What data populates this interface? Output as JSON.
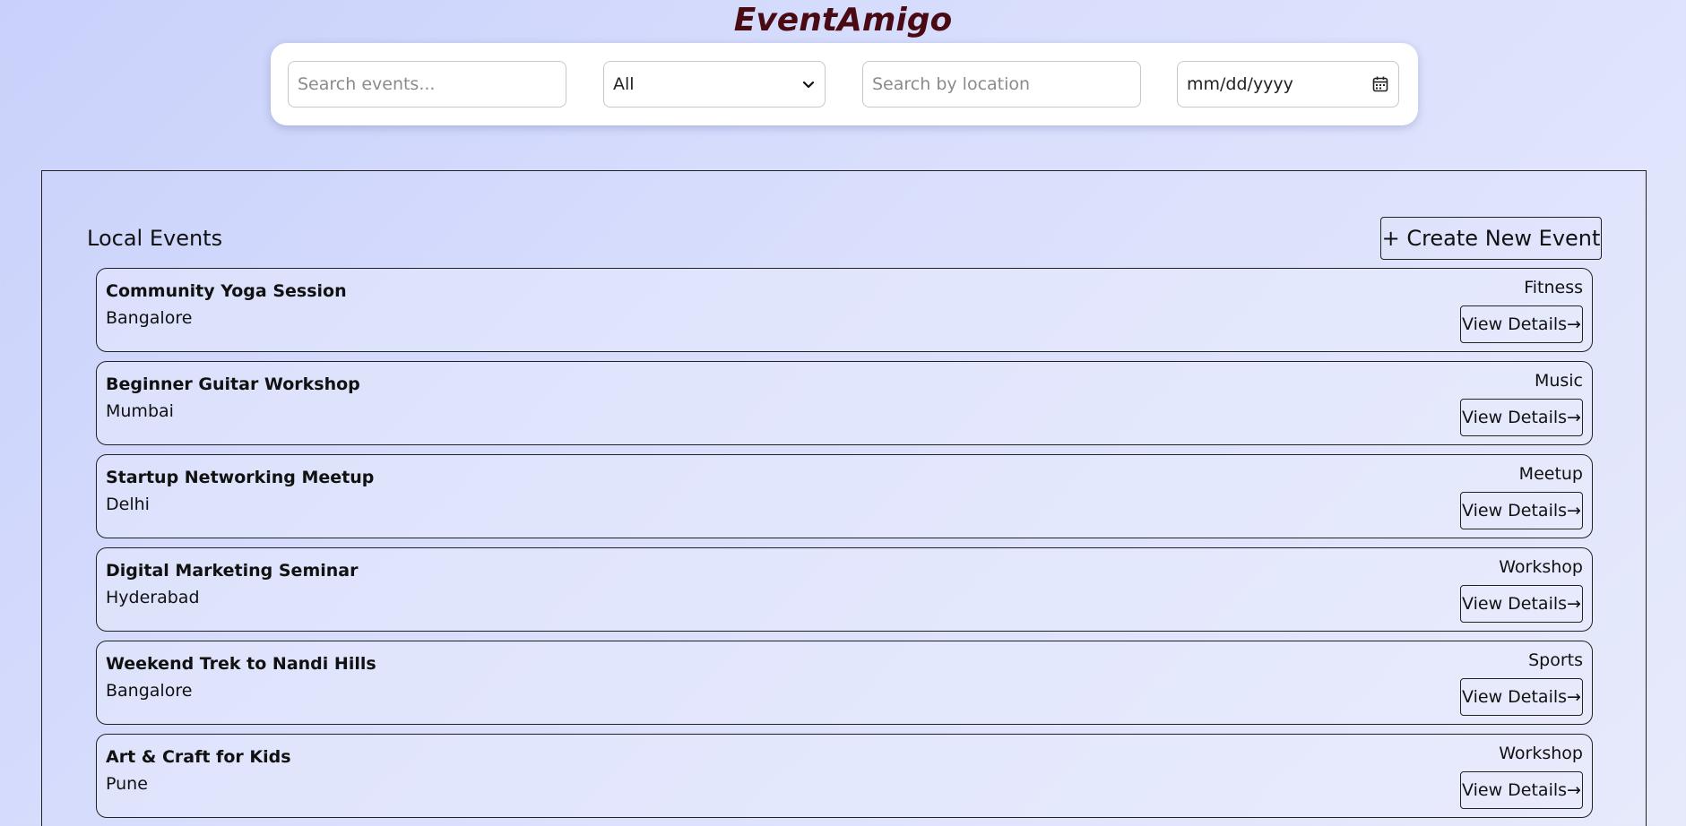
{
  "app": {
    "title": "EventAmigo"
  },
  "filters": {
    "search_placeholder": "Search events...",
    "category_value": "All",
    "location_placeholder": "Search by location",
    "date_placeholder": "mm/dd/yyyy"
  },
  "section": {
    "title": "Local Events",
    "create_label": "+ Create New Event"
  },
  "events": [
    {
      "title": "Community Yoga Session",
      "location": "Bangalore",
      "category": "Fitness",
      "action": "View Details→"
    },
    {
      "title": "Beginner Guitar Workshop",
      "location": "Mumbai",
      "category": "Music",
      "action": "View Details→"
    },
    {
      "title": "Startup Networking Meetup",
      "location": "Delhi",
      "category": "Meetup",
      "action": "View Details→"
    },
    {
      "title": "Digital Marketing Seminar",
      "location": "Hyderabad",
      "category": "Workshop",
      "action": "View Details→"
    },
    {
      "title": "Weekend Trek to Nandi Hills",
      "location": "Bangalore",
      "category": "Sports",
      "action": "View Details→"
    },
    {
      "title": "Art & Craft for Kids",
      "location": "Pune",
      "category": "Workshop",
      "action": "View Details→"
    }
  ],
  "colors": {
    "title": "#4a0a14",
    "background_start": "#c9d1fb",
    "background_end": "#e7eafb"
  },
  "icons": {
    "select_arrow": "chevron-down-icon",
    "date_picker": "calendar-icon"
  }
}
